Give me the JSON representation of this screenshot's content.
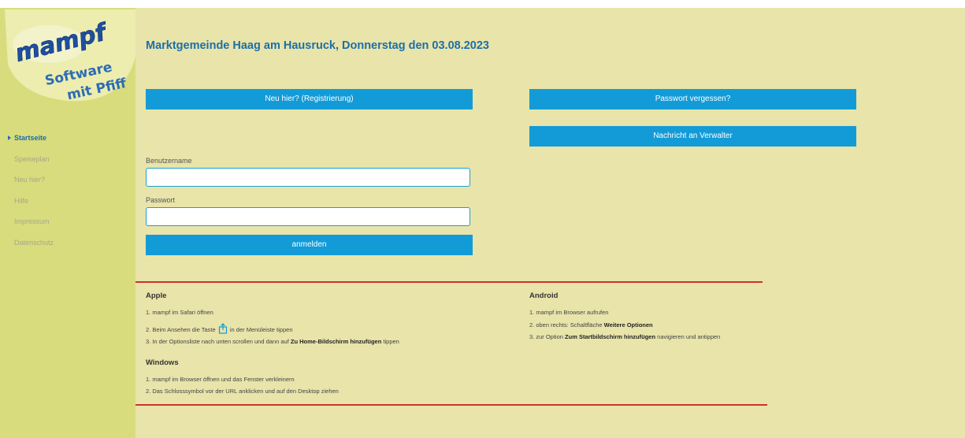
{
  "logo": {
    "wordmark": "mampf",
    "tagline_1": "Software",
    "tagline_2": "mit Pfiff"
  },
  "sidebar": {
    "items": [
      {
        "label": "Startseite",
        "active": true
      },
      {
        "label": "Speiseplan",
        "active": false
      },
      {
        "label": "Neu hier?",
        "active": false
      },
      {
        "label": "Hilfe",
        "active": false
      },
      {
        "label": "Impressum",
        "active": false
      },
      {
        "label": "Datenschutz",
        "active": false
      }
    ]
  },
  "header": {
    "title": "Marktgemeinde Haag am Hausruck, Donnerstag den 03.08.2023"
  },
  "buttons": {
    "register": "Neu hier? (Registrierung)",
    "forgot_password": "Passwort vergessen?",
    "message_admin": "Nachricht an Verwalter",
    "login": "anmelden"
  },
  "form": {
    "username_label": "Benutzername",
    "username_value": "",
    "password_label": "Passwort",
    "password_value": ""
  },
  "instructions": {
    "apple": {
      "title": "Apple",
      "line1": "1. mampf im Safari öffnen",
      "line2_pre": "2. Beim Ansehen die Taste",
      "line2_post": "in der Menüleiste tippen",
      "line3_pre": "3. In der Optionsliste nach unten scrollen und dann auf",
      "line3_bold": "Zu Home-Bildschirm hinzufügen",
      "line3_post": "tippen"
    },
    "android": {
      "title": "Android",
      "line1": "1. mampf im Browser aufrufen",
      "line2_pre": "2. oben rechts: Schaltfläche",
      "line2_bold": "Weitere Optionen",
      "line3_pre": "3. zur Option",
      "line3_bold": "Zum Startbildschirm hinzufügen",
      "line3_post": "navigieren und antippen"
    },
    "windows": {
      "title": "Windows",
      "line1": "1. mampf im Browser öffnen und das Fenster verkleinern",
      "line2": "2. Das Schlosssymbol vor der URL anklicken und auf den Desktop ziehen"
    }
  },
  "colors": {
    "background": "#e8e4aa",
    "sidebar": "#d9dc7c",
    "accent_blue": "#139bd8",
    "title_blue": "#1d6fa7",
    "divider_red": "#d0312d"
  }
}
